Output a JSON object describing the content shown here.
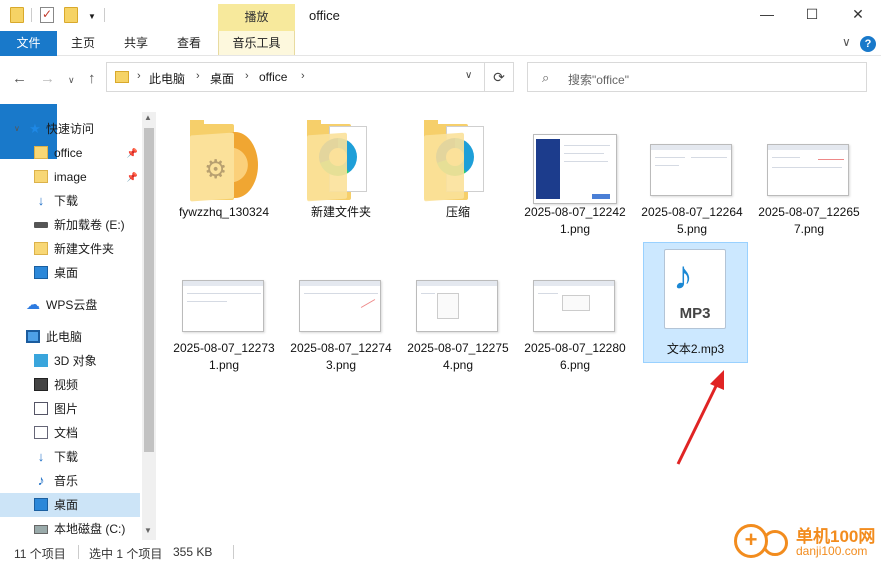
{
  "window": {
    "title": "office",
    "context_tab": "播放",
    "minimize": "—",
    "maximize": "☐",
    "close": "✕"
  },
  "ribbon": {
    "tabs": [
      "文件",
      "主页",
      "共享",
      "查看",
      "音乐工具"
    ],
    "collapse": "∨"
  },
  "address": {
    "crumbs": [
      "此电脑",
      "桌面",
      "office"
    ],
    "search_placeholder": "搜索\"office\""
  },
  "sidebar": {
    "items": [
      {
        "label": "快速访问",
        "icon": "star-icon"
      },
      {
        "label": "office",
        "icon": "folder-icon",
        "pinned": true
      },
      {
        "label": "image",
        "icon": "folder-icon",
        "pinned": true
      },
      {
        "label": "下载",
        "icon": "download-icon"
      },
      {
        "label": "新加载卷 (E:)",
        "icon": "drive-icon"
      },
      {
        "label": "新建文件夹",
        "icon": "folder-icon"
      },
      {
        "label": "桌面",
        "icon": "desktop-icon"
      },
      {
        "label": "WPS云盘",
        "icon": "cloud-icon"
      },
      {
        "label": "此电脑",
        "icon": "computer-icon"
      },
      {
        "label": "3D 对象",
        "icon": "3d-objects-icon"
      },
      {
        "label": "视频",
        "icon": "video-icon"
      },
      {
        "label": "图片",
        "icon": "pictures-icon"
      },
      {
        "label": "文档",
        "icon": "documents-icon"
      },
      {
        "label": "下载",
        "icon": "download-icon"
      },
      {
        "label": "音乐",
        "icon": "music-icon"
      },
      {
        "label": "桌面",
        "icon": "desktop-icon"
      },
      {
        "label": "本地磁盘 (C:)",
        "icon": "disk-icon"
      }
    ]
  },
  "files": [
    {
      "name": "fywzzhq_130324",
      "type": "folder"
    },
    {
      "name": "新建文件夹",
      "type": "folder"
    },
    {
      "name": "压缩",
      "type": "folder"
    },
    {
      "name": "2025-08-07_122421.png",
      "type": "image"
    },
    {
      "name": "2025-08-07_122645.png",
      "type": "image"
    },
    {
      "name": "2025-08-07_122657.png",
      "type": "image"
    },
    {
      "name": "2025-08-07_122731.png",
      "type": "image"
    },
    {
      "name": "2025-08-07_122743.png",
      "type": "image"
    },
    {
      "name": "2025-08-07_122754.png",
      "type": "image"
    },
    {
      "name": "2025-08-07_122806.png",
      "type": "image"
    },
    {
      "name": "文本2.mp3",
      "type": "audio",
      "selected": true,
      "icon_label": "MP3"
    }
  ],
  "status": {
    "count": "11 个项目",
    "selection": "选中 1 个项目",
    "size": "355 KB"
  },
  "watermark": {
    "text1": "单机100网",
    "text2": "danji100.com"
  },
  "colors": {
    "accent": "#1979ca",
    "selection": "#cce8ff",
    "context_tab": "#f7e99c",
    "arrow": "#e02424"
  }
}
